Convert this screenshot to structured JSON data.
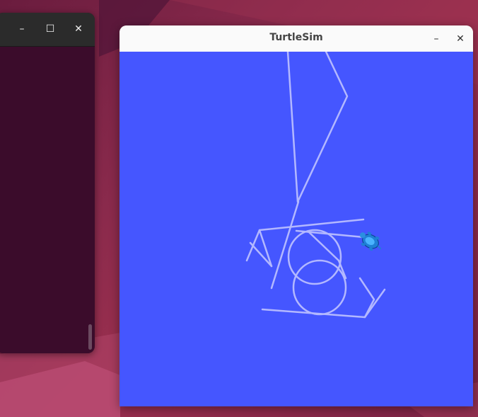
{
  "desktop": {
    "background_color": "#8a2a4c"
  },
  "terminal_window": {
    "minimize_symbol": "–",
    "maximize_symbol": "☐",
    "close_symbol": "✕",
    "background_color": "#3b0c2b"
  },
  "turtlesim_window": {
    "title": "TurtleSim",
    "minimize_symbol": "–",
    "close_symbol": "✕",
    "canvas_color": "#4556ff",
    "pen_color": "#b3b8ff",
    "turtle_icon": "turtle-icon"
  }
}
